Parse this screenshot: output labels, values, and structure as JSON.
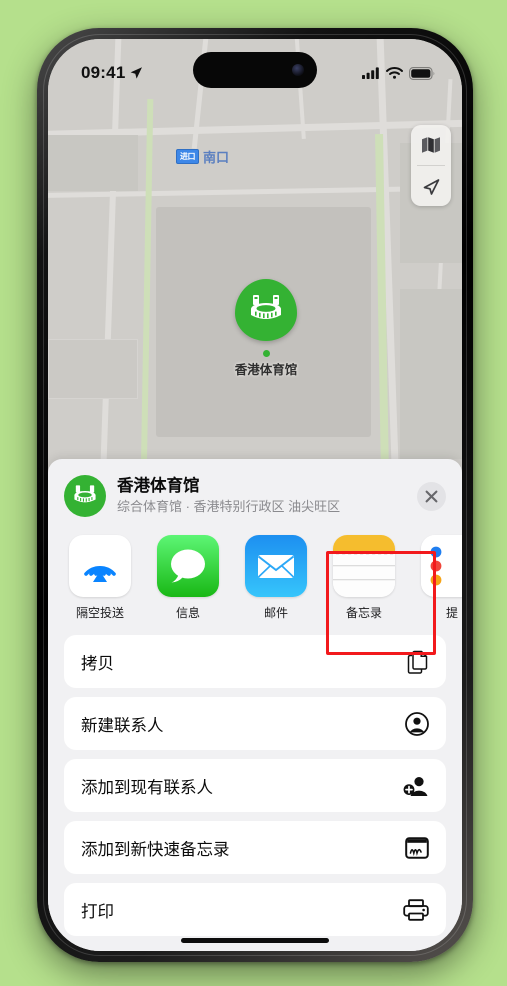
{
  "status_bar": {
    "time": "09:41",
    "location_arrow_icon": "location-arrow-icon",
    "cellular_icon": "cellular-bars-icon",
    "wifi_icon": "wifi-icon",
    "battery_icon": "battery-full-icon"
  },
  "map": {
    "transit_badge": "进口",
    "transit_label": "南口",
    "poi_label": "香港体育馆",
    "poi_icon": "stadium-icon",
    "controls": [
      {
        "name": "map-layers-button",
        "icon": "map-layers-icon"
      },
      {
        "name": "locate-me-button",
        "icon": "navigation-arrow-icon"
      }
    ]
  },
  "share_sheet": {
    "title": "香港体育馆",
    "subtitle": "综合体育馆 · 香港特别行政区 油尖旺区",
    "poi_icon": "stadium-icon",
    "close_icon": "close-icon",
    "apps": [
      {
        "name": "app-airdrop",
        "label": "隔空投送",
        "icon": "airdrop-icon"
      },
      {
        "name": "app-messages",
        "label": "信息",
        "icon": "messages-icon"
      },
      {
        "name": "app-mail",
        "label": "邮件",
        "icon": "mail-icon"
      },
      {
        "name": "app-notes",
        "label": "备忘录",
        "icon": "notes-icon",
        "highlighted": true
      },
      {
        "name": "app-reminders",
        "label": "提",
        "icon": "reminders-icon"
      }
    ],
    "actions": [
      {
        "name": "action-copy",
        "label": "拷贝",
        "icon": "copy-documents-icon"
      },
      {
        "name": "action-new-contact",
        "label": "新建联系人",
        "icon": "person-circle-icon"
      },
      {
        "name": "action-add-to-contact",
        "label": "添加到现有联系人",
        "icon": "person-add-icon"
      },
      {
        "name": "action-new-quick-note",
        "label": "添加到新快速备忘录",
        "icon": "quick-note-icon"
      },
      {
        "name": "action-print",
        "label": "打印",
        "icon": "printer-icon"
      }
    ]
  },
  "colors": {
    "background": "#b5e08c",
    "accent_green": "#34b233",
    "highlight_red": "#f2191c",
    "sheet_background": "#f1f1f3"
  }
}
